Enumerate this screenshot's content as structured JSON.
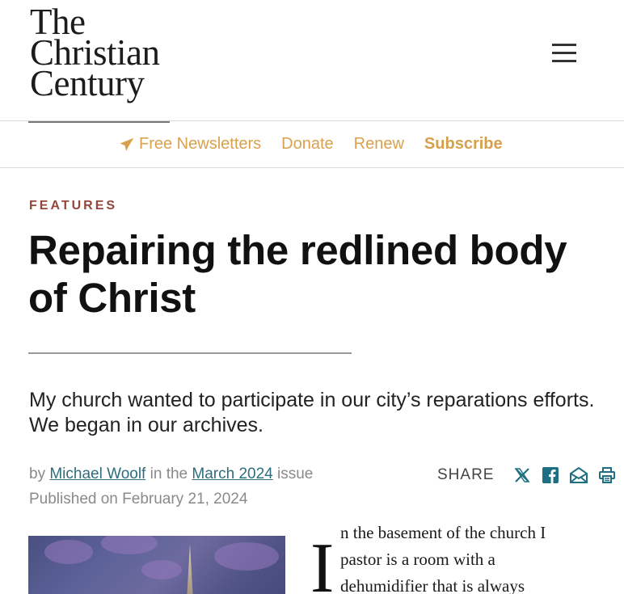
{
  "site": {
    "logo_lines": [
      "The",
      "Christian",
      "Century"
    ]
  },
  "nav": {
    "newsletters": "Free Newsletters",
    "donate": "Donate",
    "renew": "Renew",
    "subscribe": "Subscribe"
  },
  "article": {
    "kicker": "FEATURES",
    "title": "Repairing the redlined body of Christ",
    "dek": "My church wanted to participate in our city’s reparations efforts. We began in our archives.",
    "byline": {
      "by": "by",
      "author": "Michael Woolf",
      "in_the": "in the",
      "issue": "March 2024",
      "issue_suffix": "issue"
    },
    "published": "Published on February 21, 2024",
    "share_label": "SHARE",
    "share_icons": [
      "x-icon",
      "facebook-icon",
      "email-icon",
      "print-icon"
    ],
    "dropcap": "I",
    "body_lines": [
      "n the basement of the church I",
      "pastor is a room with a",
      "dehumidifier that is always"
    ]
  },
  "colors": {
    "accent_gold": "#d9a14d",
    "kicker_red": "#93463c",
    "link_teal": "#2d6d7c",
    "share_teal": "#1f6f82"
  }
}
